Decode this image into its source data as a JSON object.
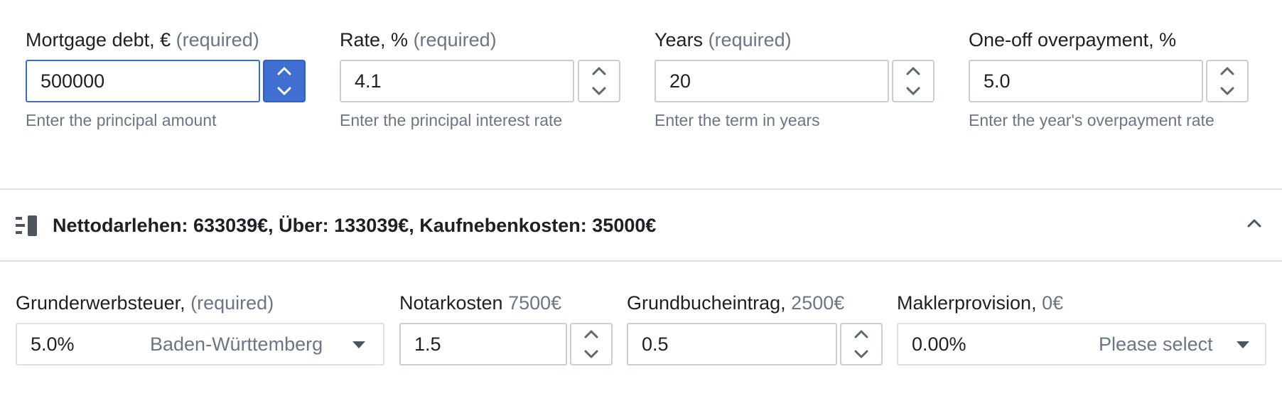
{
  "mortgage_form": {
    "fields": [
      {
        "label": "Mortgage debt, €",
        "required": "(required)",
        "value": "500000",
        "hint": "Enter the principal amount"
      },
      {
        "label": "Rate, %",
        "required": "(required)",
        "value": "4.1",
        "hint": "Enter the principal interest rate"
      },
      {
        "label": "Years",
        "required": "(required)",
        "value": "20",
        "hint": "Enter the term in years"
      },
      {
        "label": "One-off overpayment, %",
        "value": "5.0",
        "hint": "Enter the year's overpayment rate"
      }
    ]
  },
  "summary_section": {
    "title": "Nettodarlehen: 633039€, Über: 133039€, Kaufnebenkosten: 35000€",
    "icon": "list-icon",
    "toggle_icon": "chevron-up-icon"
  },
  "costs": {
    "grunderwerbsteuer": {
      "label": "Grunderwerbsteuer,",
      "extra": "(required)",
      "value": "5.0%",
      "option": "Baden-Württemberg"
    },
    "notarkosten": {
      "label": "Notarkosten",
      "extra": "7500€",
      "value": "1.5"
    },
    "grundbucheintrag": {
      "label": "Grundbucheintrag,",
      "extra": "2500€",
      "value": "0.5"
    },
    "maklerprovision": {
      "label": "Maklerprovision,",
      "extra": "0€",
      "value": "0.00%",
      "option": "Please select"
    }
  },
  "colors": {
    "accent": "#3f6fd0",
    "muted_text": "#6a7585",
    "border": "#c9ced6"
  }
}
